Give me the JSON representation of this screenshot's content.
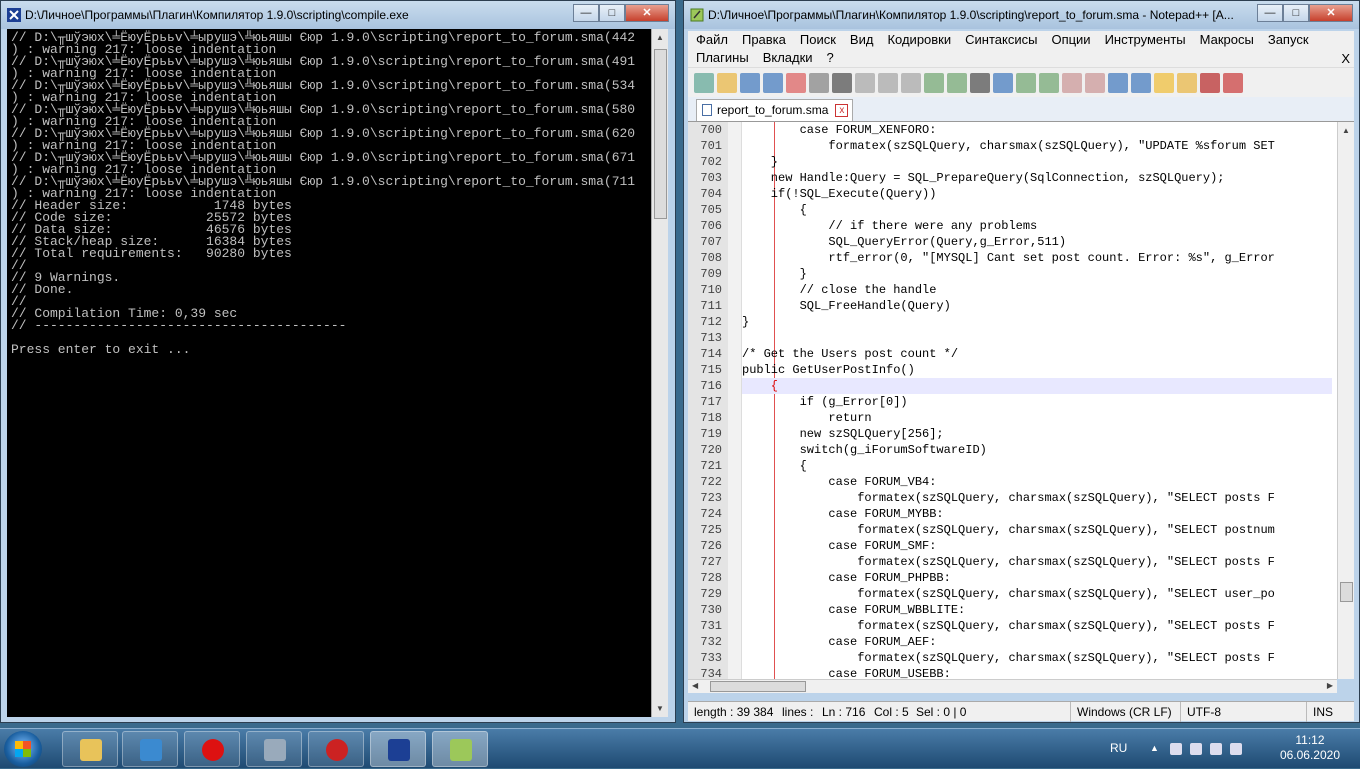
{
  "cmd": {
    "title": "D:\\Личное\\Программы\\Плагин\\Компилятор 1.9.0\\scripting\\compile.exe",
    "lines": [
      "// D:\\╥шўэюх\\╧ЁюуЁрььv\\╧ырушэ\\╩юьяшы Єюр 1.9.0\\scripting\\report_to_forum.sma(442",
      ") : warning 217: loose indentation",
      "// D:\\╥шўэюх\\╧ЁюуЁрььv\\╧ырушэ\\╩юьяшы Єюр 1.9.0\\scripting\\report_to_forum.sma(491",
      ") : warning 217: loose indentation",
      "// D:\\╥шўэюх\\╧ЁюуЁрььv\\╧ырушэ\\╩юьяшы Єюр 1.9.0\\scripting\\report_to_forum.sma(534",
      ") : warning 217: loose indentation",
      "// D:\\╥шўэюх\\╧ЁюуЁрььv\\╧ырушэ\\╩юьяшы Єюр 1.9.0\\scripting\\report_to_forum.sma(580",
      ") : warning 217: loose indentation",
      "// D:\\╥шўэюх\\╧ЁюуЁрььv\\╧ырушэ\\╩юьяшы Єюр 1.9.0\\scripting\\report_to_forum.sma(620",
      ") : warning 217: loose indentation",
      "// D:\\╥шўэюх\\╧ЁюуЁрььv\\╧ырушэ\\╩юьяшы Єюр 1.9.0\\scripting\\report_to_forum.sma(671",
      ") : warning 217: loose indentation",
      "// D:\\╥шўэюх\\╧ЁюуЁрььv\\╧ырушэ\\╩юьяшы Єюр 1.9.0\\scripting\\report_to_forum.sma(711",
      ") : warning 217: loose indentation",
      "// Header size:           1748 bytes",
      "// Code size:            25572 bytes",
      "// Data size:            46576 bytes",
      "// Stack/heap size:      16384 bytes",
      "// Total requirements:   90280 bytes",
      "//",
      "// 9 Warnings.",
      "// Done.",
      "//",
      "// Compilation Time: 0,39 sec",
      "// ----------------------------------------",
      "",
      "Press enter to exit ..."
    ]
  },
  "npp": {
    "title": "D:\\Личное\\Программы\\Плагин\\Компилятор 1.9.0\\scripting\\report_to_forum.sma - Notepad++ [A...",
    "menu_row1": [
      "Файл",
      "Правка",
      "Поиск",
      "Вид",
      "Кодировки",
      "Синтаксисы",
      "Опции",
      "Инструменты",
      "Макросы",
      "Запуск"
    ],
    "menu_row2": [
      "Плагины",
      "Вкладки",
      "?"
    ],
    "menu_close": "X",
    "tab_label": "report_to_forum.sma",
    "tab_close": "x",
    "line_numbers": [
      "700",
      "701",
      "702",
      "703",
      "704",
      "705",
      "706",
      "707",
      "708",
      "709",
      "710",
      "711",
      "712",
      "713",
      "714",
      "715",
      "716",
      "717",
      "718",
      "719",
      "720",
      "721",
      "722",
      "723",
      "724",
      "725",
      "726",
      "727",
      "728",
      "729",
      "730",
      "731",
      "732",
      "733",
      "734"
    ],
    "code": [
      "        case FORUM_XENFORO:",
      "            formatex(szSQLQuery, charsmax(szSQLQuery), \"UPDATE %sforum SET",
      "    }",
      "    new Handle:Query = SQL_PrepareQuery(SqlConnection, szSQLQuery);",
      "    if(!SQL_Execute(Query))",
      "        {",
      "            // if there were any problems",
      "            SQL_QueryError(Query,g_Error,511)",
      "            rtf_error(0, \"[MYSQL] Cant set post count. Error: %s\", g_Error",
      "        }",
      "        // close the handle",
      "        SQL_FreeHandle(Query)",
      "}",
      "",
      "/* Get the Users post count */",
      "public GetUserPostInfo()",
      "    {",
      "        if (g_Error[0])",
      "            return",
      "        new szSQLQuery[256];",
      "        switch(g_iForumSoftwareID)",
      "        {",
      "            case FORUM_VB4:",
      "                formatex(szSQLQuery, charsmax(szSQLQuery), \"SELECT posts F",
      "            case FORUM_MYBB:",
      "                formatex(szSQLQuery, charsmax(szSQLQuery), \"SELECT postnum",
      "            case FORUM_SMF:",
      "                formatex(szSQLQuery, charsmax(szSQLQuery), \"SELECT posts F",
      "            case FORUM_PHPBB:",
      "                formatex(szSQLQuery, charsmax(szSQLQuery), \"SELECT user_po",
      "            case FORUM_WBBLITE:",
      "                formatex(szSQLQuery, charsmax(szSQLQuery), \"SELECT posts F",
      "            case FORUM_AEF:",
      "                formatex(szSQLQuery, charsmax(szSQLQuery), \"SELECT posts F",
      "            case FORUM_USEBB:"
    ],
    "status": {
      "length": "length : 39 384",
      "lines": "lines :",
      "ln": "Ln : 716",
      "col": "Col : 5",
      "sel": "Sel : 0 | 0",
      "eol": "Windows (CR LF)",
      "encoding": "UTF-8",
      "mode": "INS"
    }
  },
  "taskbar": {
    "lang": "RU",
    "time": "11:12",
    "date": "06.06.2020"
  }
}
